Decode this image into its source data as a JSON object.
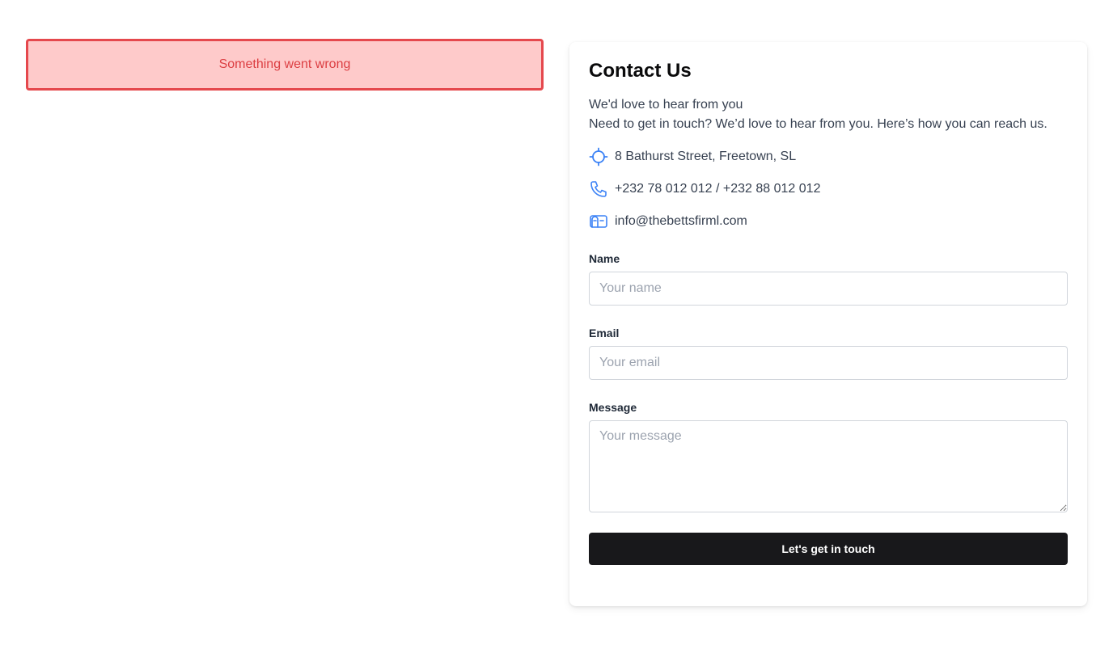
{
  "error": {
    "message": "Something went wrong"
  },
  "contact": {
    "title": "Contact Us",
    "tagline": "We'd love to hear from you",
    "description": "Need to get in touch? We’d love to hear from you. Here’s how you can reach us.",
    "items": [
      {
        "icon": "location-crosshair-icon",
        "text": "8 Bathurst Street, Freetown, SL"
      },
      {
        "icon": "phone-icon",
        "text": "+232 78 012 012 / +232 88 012 012"
      },
      {
        "icon": "mailbox-icon",
        "text": "info@thebettsfirml.com"
      }
    ],
    "icon_color": "#3b82f6"
  },
  "form": {
    "name_label": "Name",
    "name_placeholder": "Your name",
    "name_value": "",
    "email_label": "Email",
    "email_placeholder": "Your email",
    "email_value": "",
    "message_label": "Message",
    "message_placeholder": "Your message",
    "message_value": "",
    "submit_label": "Let's get in touch"
  },
  "colors": {
    "error_bg": "#fecaca",
    "error_border": "#e5484d",
    "error_text": "#dc3e42",
    "button_bg": "#18181b"
  }
}
